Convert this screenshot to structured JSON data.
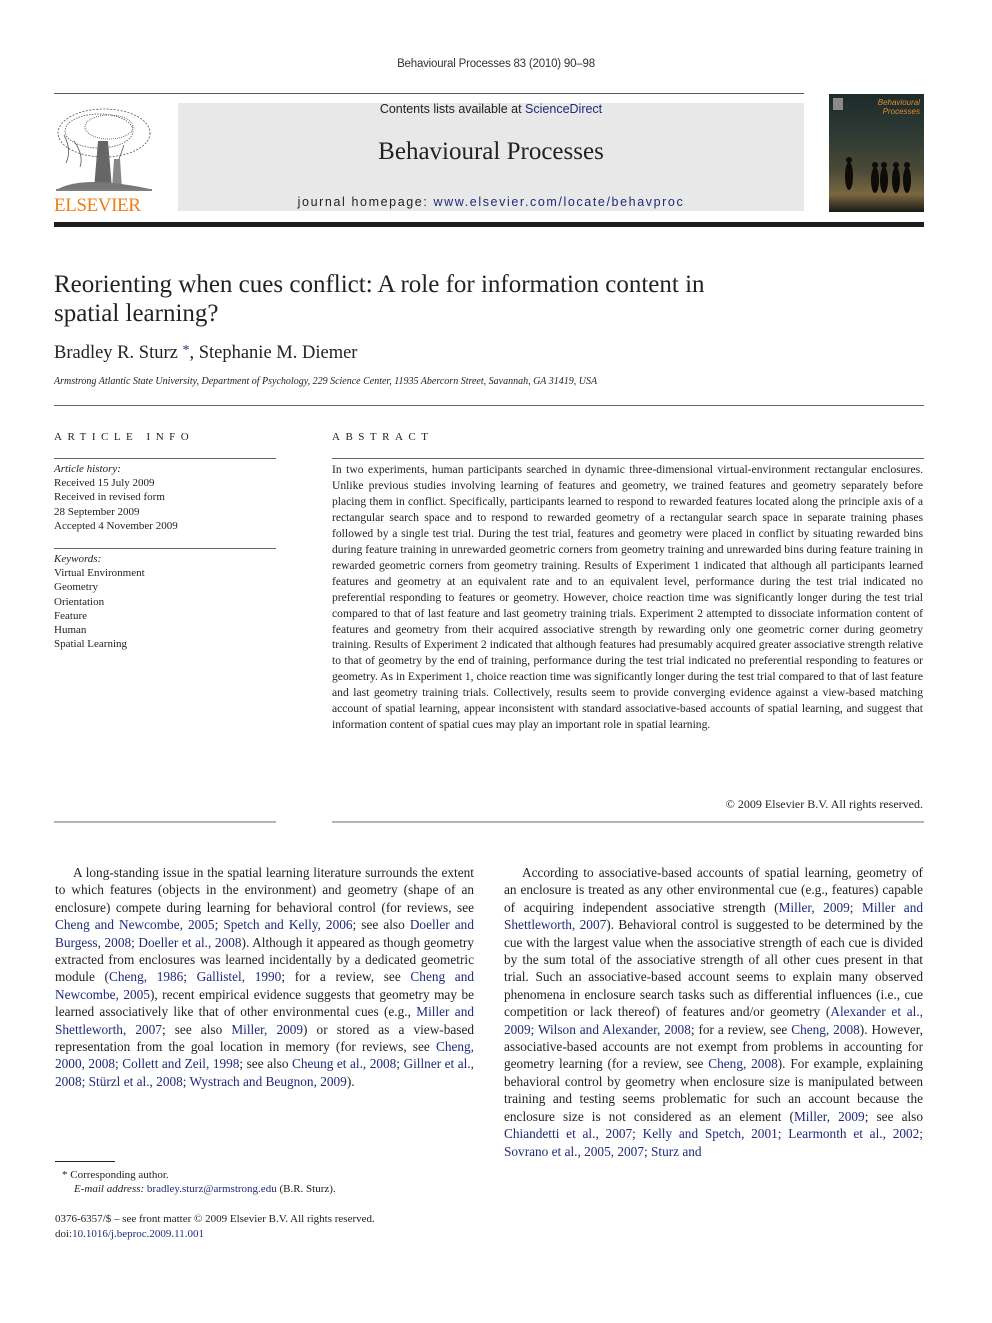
{
  "running_head": "Behavioural Processes 83 (2010) 90–98",
  "banner": {
    "contents_prefix": "Contents lists available at ",
    "contents_link": "ScienceDirect",
    "journal_title": "Behavioural Processes",
    "homepage_prefix": "journal homepage: ",
    "homepage_link": "www.elsevier.com/locate/behavproc"
  },
  "publisher_logo": {
    "wordmark": "ELSEVIER",
    "icon": "elsevier-tree-logo",
    "color": "#f07d16"
  },
  "cover": {
    "title_line1": "Behavioural",
    "title_line2": "Processes",
    "image": "meerkats-cover-image"
  },
  "article": {
    "title": "Reorienting when cues conflict: A role for information content in spatial learning?",
    "authors": [
      {
        "name": "Bradley R. Sturz",
        "marker": "*"
      },
      {
        "name": "Stephanie M. Diemer",
        "marker": ""
      }
    ],
    "author_separator": ", ",
    "affiliation": "Armstrong Atlantic State University, Department of Psychology, 229 Science Center, 11935 Abercorn Street, Savannah, GA 31419, USA"
  },
  "article_info": {
    "heading": "ARTICLE INFO",
    "history_label": "Article history:",
    "history": [
      "Received 15 July 2009",
      "Received in revised form",
      "28 September 2009",
      "Accepted 4 November 2009"
    ],
    "keywords_label": "Keywords:",
    "keywords": [
      "Virtual Environment",
      "Geometry",
      "Orientation",
      "Feature",
      "Human",
      "Spatial Learning"
    ]
  },
  "abstract": {
    "heading": "ABSTRACT",
    "text": "In two experiments, human participants searched in dynamic three-dimensional virtual-environment rectangular enclosures. Unlike previous studies involving learning of features and geometry, we trained features and geometry separately before placing them in conflict. Specifically, participants learned to respond to rewarded features located along the principle axis of a rectangular search space and to respond to rewarded geometry of a rectangular search space in separate training phases followed by a single test trial. During the test trial, features and geometry were placed in conflict by situating rewarded bins during feature training in unrewarded geometric corners from geometry training and unrewarded bins during feature training in rewarded geometric corners from geometry training. Results of Experiment 1 indicated that although all participants learned features and geometry at an equivalent rate and to an equivalent level, performance during the test trial indicated no preferential responding to features or geometry. However, choice reaction time was significantly longer during the test trial compared to that of last feature and last geometry training trials. Experiment 2 attempted to dissociate information content of features and geometry from their acquired associative strength by rewarding only one geometric corner during geometry training. Results of Experiment 2 indicated that although features had presumably acquired greater associative strength relative to that of geometry by the end of training, performance during the test trial indicated no preferential responding to features or geometry. As in Experiment 1, choice reaction time was significantly longer during the test trial compared to that of last feature and last geometry training trials. Collectively, results seem to provide converging evidence against a view-based matching account of spatial learning, appear inconsistent with standard associative-based accounts of spatial learning, and suggest that information content of spatial cues may play an important role in spatial learning.",
    "copyright": "© 2009 Elsevier B.V. All rights reserved."
  },
  "body": {
    "left_column": [
      {
        "t": "A long-standing issue in the spatial learning literature surrounds the extent to which features (objects in the environment) and geometry (shape of an enclosure) compete during learning for behavioral control (for reviews, see "
      },
      {
        "l": "Cheng and Newcombe, 2005; Spetch and Kelly, 2006"
      },
      {
        "t": "; see also "
      },
      {
        "l": "Doeller and Burgess, 2008; Doeller et al., 2008"
      },
      {
        "t": "). Although it appeared as though geometry extracted from enclosures was learned incidentally by a dedicated geometric module ("
      },
      {
        "l": "Cheng, 1986; Gallistel, 1990"
      },
      {
        "t": "; for a review, see "
      },
      {
        "l": "Cheng and Newcombe, 2005"
      },
      {
        "t": "), recent empirical evidence suggests that geometry may be learned associatively like that of other environmental cues (e.g., "
      },
      {
        "l": "Miller and Shettleworth, 2007"
      },
      {
        "t": "; see also "
      },
      {
        "l": "Miller, 2009"
      },
      {
        "t": ") or stored as a view-based representation from the goal location in memory (for reviews, see "
      },
      {
        "l": "Cheng, 2000, 2008; Collett and Zeil, 1998"
      },
      {
        "t": "; see also "
      },
      {
        "l": "Cheung et al., 2008; Gillner et al., 2008; Stürzl et al., 2008; Wystrach and Beugnon, 2009"
      },
      {
        "t": ")."
      }
    ],
    "right_column": [
      {
        "t": "According to associative-based accounts of spatial learning, geometry of an enclosure is treated as any other environmental cue (e.g., features) capable of acquiring independent associative strength ("
      },
      {
        "l": "Miller, 2009; Miller and Shettleworth, 2007"
      },
      {
        "t": "). Behavioral control is suggested to be determined by the cue with the largest value when the associative strength of each cue is divided by the sum total of the associative strength of all other cues present in that trial. Such an associative-based account seems to explain many observed phenomena in enclosure search tasks such as differential influences (i.e., cue competition or lack thereof) of features and/or geometry ("
      },
      {
        "l": "Alexander et al., 2009; Wilson and Alexander, 2008"
      },
      {
        "t": "; for a review, see "
      },
      {
        "l": "Cheng, 2008"
      },
      {
        "t": "). However, associative-based accounts are not exempt from problems in accounting for geometry learning (for a review, see "
      },
      {
        "l": "Cheng, 2008"
      },
      {
        "t": "). For example, explaining behavioral control by geometry when enclosure size is manipulated between training and testing seems problematic for such an account because the enclosure size is not considered as an element ("
      },
      {
        "l": "Miller, 2009"
      },
      {
        "t": "; see also "
      },
      {
        "l": "Chiandetti et al., 2007; Kelly and Spetch, 2001; Learmonth et al., 2002; Sovrano et al., 2005, 2007; Sturz and"
      }
    ]
  },
  "footnote": {
    "marker": "*",
    "label": "Corresponding author.",
    "email_label": "E-mail address: ",
    "email": "bradley.sturz@armstrong.edu",
    "email_suffix": " (B.R. Sturz)."
  },
  "front_matter": {
    "issn_line": "0376-6357/$ – see front matter © 2009 Elsevier B.V. All rights reserved.",
    "doi_prefix": "doi:",
    "doi": "10.1016/j.beproc.2009.11.001"
  },
  "colors": {
    "link": "#1f2a7a",
    "elsevier_orange": "#f07d16",
    "banner_bg": "#e8e8e9"
  }
}
